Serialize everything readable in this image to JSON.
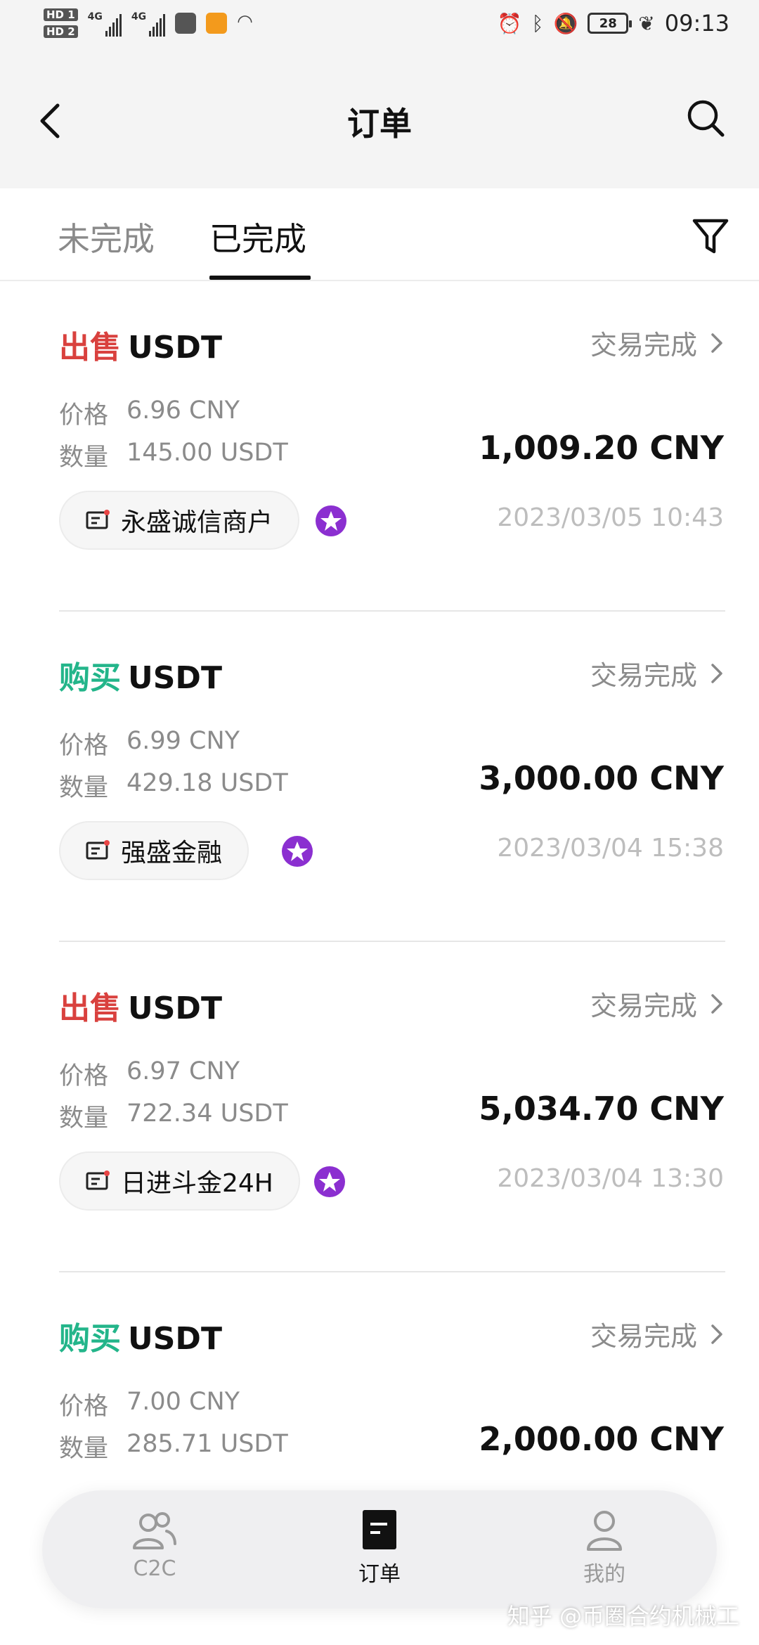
{
  "status_bar": {
    "sim1": "HD 1",
    "sim2": "HD 2",
    "net1": "4G",
    "net2": "4G",
    "battery": "28",
    "time": "09:13"
  },
  "header": {
    "title": "订单"
  },
  "tabs": [
    {
      "label": "未完成",
      "active": false
    },
    {
      "label": "已完成",
      "active": true
    }
  ],
  "orders": [
    {
      "side": "出售",
      "side_type": "sell",
      "coin": "USDT",
      "status": "交易完成",
      "price_label": "价格",
      "price": "6.96 CNY",
      "qty_label": "数量",
      "qty": "145.00 USDT",
      "total": "1,009.20 CNY",
      "merchant": "永盛诚信商户",
      "date": "2023/03/05 10:43"
    },
    {
      "side": "购买",
      "side_type": "buy",
      "coin": "USDT",
      "status": "交易完成",
      "price_label": "价格",
      "price": "6.99 CNY",
      "qty_label": "数量",
      "qty": "429.18 USDT",
      "total": "3,000.00 CNY",
      "merchant": "强盛金融",
      "date": "2023/03/04 15:38"
    },
    {
      "side": "出售",
      "side_type": "sell",
      "coin": "USDT",
      "status": "交易完成",
      "price_label": "价格",
      "price": "6.97 CNY",
      "qty_label": "数量",
      "qty": "722.34 USDT",
      "total": "5,034.70 CNY",
      "merchant": "日进斗金24H",
      "date": "2023/03/04 13:30"
    },
    {
      "side": "购买",
      "side_type": "buy",
      "coin": "USDT",
      "status": "交易完成",
      "price_label": "价格",
      "price": "7.00 CNY",
      "qty_label": "数量",
      "qty": "285.71 USDT",
      "total": "2,000.00 CNY"
    }
  ],
  "bottom_nav": [
    {
      "label": "C2C",
      "icon": "users-icon",
      "active": false
    },
    {
      "label": "订单",
      "icon": "orders-icon",
      "active": true
    },
    {
      "label": "我的",
      "icon": "user-icon",
      "active": false
    }
  ],
  "watermark": "知乎 @币圈合约机械工",
  "colors": {
    "sell": "#d9413e",
    "buy": "#23b58a",
    "badge": "#8b2fd0"
  }
}
